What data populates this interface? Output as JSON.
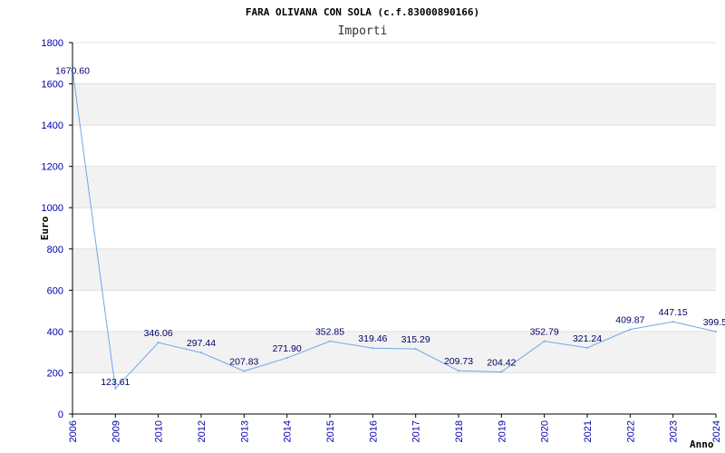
{
  "chart_data": {
    "type": "line",
    "title": "FARA OLIVANA CON SOLA (c.f.83000890166)",
    "subtitle": "Importi",
    "xlabel": "Anno",
    "ylabel": "Euro",
    "ylim": [
      0,
      1800
    ],
    "yticks": [
      "0",
      "200",
      "400",
      "600",
      "800",
      "1000",
      "1200",
      "1400",
      "1600",
      "1800"
    ],
    "grid": "horizontal bands",
    "categories": [
      "2006",
      "2009",
      "2010",
      "2012",
      "2013",
      "2014",
      "2015",
      "2016",
      "2017",
      "2018",
      "2019",
      "2020",
      "2021",
      "2022",
      "2023",
      "2024"
    ],
    "values": [
      1670.6,
      123.61,
      346.06,
      297.44,
      207.83,
      271.9,
      352.85,
      319.46,
      315.29,
      209.73,
      204.42,
      352.79,
      321.24,
      409.87,
      447.15,
      399.5
    ],
    "labels": [
      "1670.60",
      "123.61",
      "346.06",
      "297.44",
      "207.83",
      "271.90",
      "352.85",
      "319.46",
      "315.29",
      "209.73",
      "204.42",
      "352.79",
      "321.24",
      "409.87",
      "447.15",
      "399.5"
    ],
    "colors": {
      "line": "#6fa8e8",
      "band": "#f2f2f2",
      "tick": "#0000aa",
      "data_label": "#000066"
    }
  }
}
